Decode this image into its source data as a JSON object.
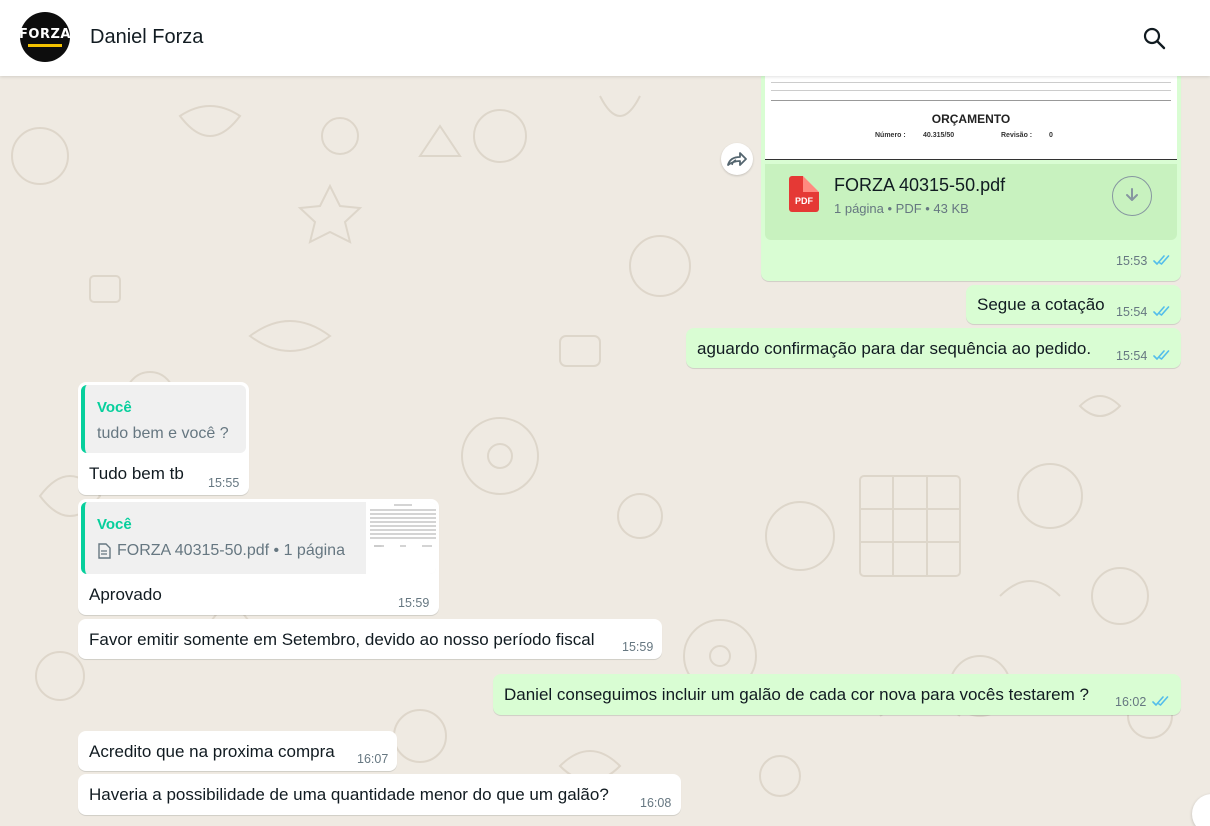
{
  "header": {
    "contact_name": "Daniel Forza",
    "avatar_text": "FORZA",
    "search_icon": "search-icon"
  },
  "colors": {
    "outgoing_bubble": "#d9fdd3",
    "incoming_bubble": "#ffffff",
    "quote_accent": "#06cf9c",
    "read_ticks": "#53bdeb",
    "chat_background": "#efeae2",
    "pdf_red": "#e53935"
  },
  "messages": {
    "document": {
      "preview": {
        "title": "ORÇAMENTO",
        "numero_label": "Número :",
        "numero_value": "40.315/50",
        "revisao_label": "Revisão :",
        "revisao_value": "0"
      },
      "file_name": "FORZA 40315-50.pdf",
      "file_meta": "1 página • PDF • 43 KB",
      "time": "15:53",
      "forward_icon": "forward-icon",
      "download_icon": "download-icon"
    },
    "m_segue": {
      "text": "Segue a cotação",
      "time": "15:54"
    },
    "m_aguardo": {
      "text": "aguardo confirmação para dar sequência ao pedido.",
      "time": "15:54"
    },
    "m_tudo_bem": {
      "quote_author": "Você",
      "quote_text": "tudo bem e você ?",
      "text": "Tudo bem tb",
      "time": "15:55"
    },
    "m_aprovado": {
      "quote_author": "Você",
      "quote_text": "FORZA 40315-50.pdf • 1 página",
      "text": "Aprovado",
      "time": "15:59"
    },
    "m_favor": {
      "text": "Favor emitir somente em Setembro, devido ao nosso período fiscal",
      "time": "15:59"
    },
    "m_daniel": {
      "text": "Daniel conseguimos incluir um galão de cada cor nova para vocês testarem ?",
      "time": "16:02"
    },
    "m_acredito": {
      "text": "Acredito que na proxima compra",
      "time": "16:07"
    },
    "m_haveria": {
      "text": "Haveria a possibilidade de uma quantidade menor do que um galão?",
      "time": "16:08"
    }
  }
}
